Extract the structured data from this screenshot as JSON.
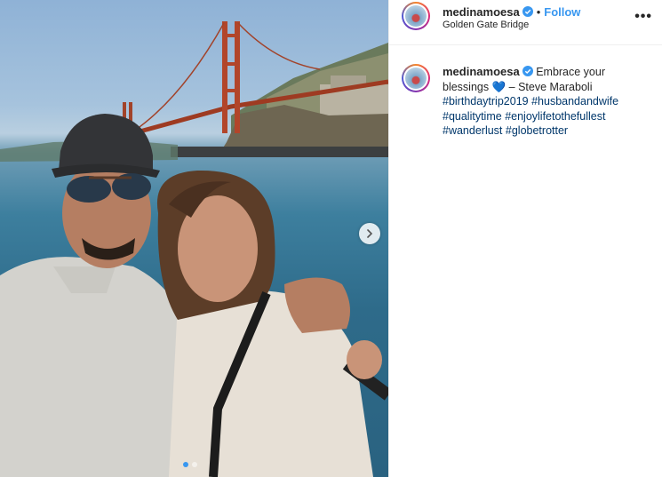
{
  "post": {
    "username": "medinamoesa",
    "follow_label": "Follow",
    "bullet": "•",
    "location": "Golden Gate Bridge",
    "more_label": "•••",
    "caption": {
      "username": "medinamoesa",
      "text_line1": "Embrace your",
      "text_line2_start": "blessings",
      "heart": "💙",
      "text_line2_end": "– Steve Maraboli",
      "hashtags": [
        "#birthdaytrip2019",
        "#husbandandwife",
        "#qualitytime",
        "#enjoylifetothefullest",
        "#wanderlust",
        "#globetrotter"
      ]
    },
    "carousel": {
      "current": 1,
      "total": 2
    }
  },
  "colors": {
    "link_blue": "#3897f0",
    "hashtag": "#00376b",
    "text": "#262626"
  },
  "icons": [
    "verified-badge-icon",
    "chevron-right-icon",
    "more-options-icon"
  ]
}
